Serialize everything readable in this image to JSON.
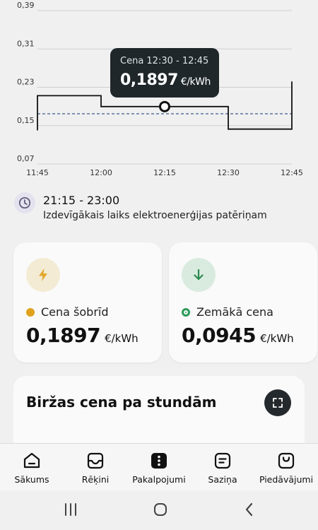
{
  "chart_data": {
    "type": "line",
    "x": [
      "11:45",
      "12:00",
      "12:15",
      "12:30",
      "12:45"
    ],
    "yticks": [
      "0,39",
      "0,31",
      "0,23",
      "0,15",
      "0,07"
    ],
    "ylim": [
      0.07,
      0.39
    ],
    "series": [
      {
        "x": [
          "11:45",
          "12:00",
          "12:15",
          "12:30",
          "12:45"
        ],
        "values": [
          0.2125,
          0.1897,
          0.1897,
          0.1427,
          0.2421
        ]
      }
    ],
    "average": 0.1747,
    "highlight": {
      "x": "12:15",
      "value": 0.1897
    },
    "grid": true,
    "colors": {
      "line": "#111111",
      "average": "#3a5a8c",
      "grid": "#cfcfcf"
    }
  },
  "tooltip": {
    "title": "Cena 12:30 - 12:45",
    "value": "0,1897",
    "unit": "€/kWh"
  },
  "best_time": {
    "icon": "clock-icon",
    "range": "21:15 - 23:00",
    "description": "Izdevīgākais laiks elektroenerģijas patēriņam"
  },
  "cards": [
    {
      "icon": "lightning-icon",
      "label": "Cena šobrīd",
      "value": "0,1897",
      "unit": "€/kWh",
      "dot_color": "#e0a21b",
      "icon_bg": "#f3ebd3",
      "icon_color": "#e2a72a"
    },
    {
      "icon": "arrow-down-icon",
      "label": "Zemākā cena",
      "value": "0,0945",
      "unit": "€/kWh",
      "dot_color": "#2d9b5a",
      "icon_bg": "#d9ebdf",
      "icon_color": "#2b8a4f"
    }
  ],
  "hourly": {
    "title": "Biržas cena pa stundām",
    "expand_icon": "expand-icon"
  },
  "nav": [
    {
      "label": "Sākums",
      "icon": "home-icon"
    },
    {
      "label": "Rēķini",
      "icon": "inbox-icon"
    },
    {
      "label": "Pakalpojumi",
      "icon": "services-icon"
    },
    {
      "label": "Saziņa",
      "icon": "message-icon"
    },
    {
      "label": "Piedāvājumi",
      "icon": "shopping-bag-icon"
    }
  ],
  "system_nav": [
    "recent-apps-icon",
    "home-circle-icon",
    "back-icon"
  ]
}
